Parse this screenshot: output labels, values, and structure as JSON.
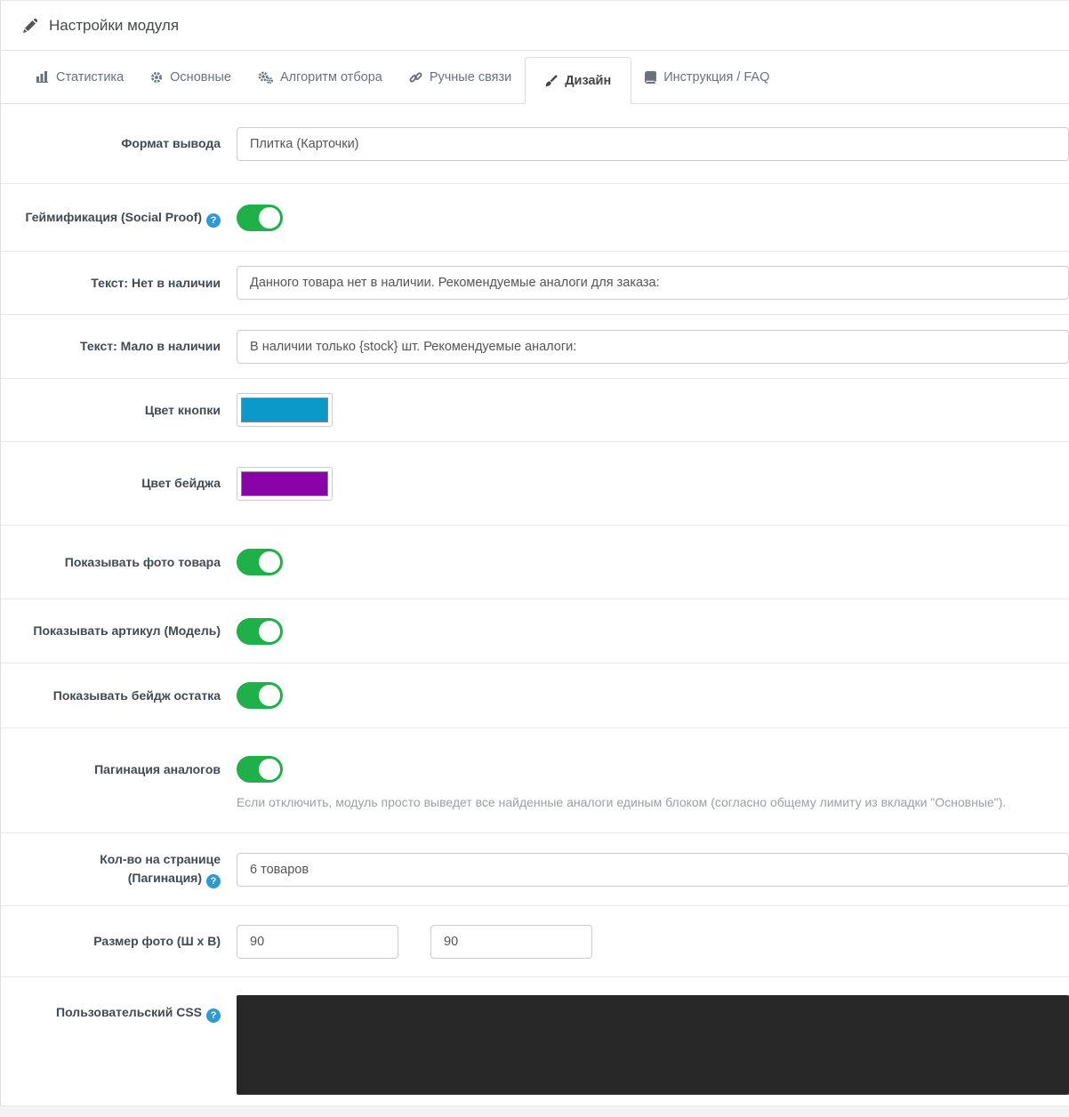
{
  "header": {
    "title": "Настройки модуля",
    "icon": "pencil-icon"
  },
  "tabs": {
    "statistics": {
      "label": "Статистика",
      "icon": "bar-chart-icon",
      "active": false
    },
    "general": {
      "label": "Основные",
      "icon": "gear-icon",
      "active": false
    },
    "algorithm": {
      "label": "Алгоритм отбора",
      "icon": "gears-icon",
      "active": false
    },
    "manual_links": {
      "label": "Ручные связи",
      "icon": "link-icon",
      "active": false
    },
    "design": {
      "label": "Дизайн",
      "icon": "paint-brush-icon",
      "active": true
    },
    "faq": {
      "label": "Инструкция / FAQ",
      "icon": "book-icon",
      "active": false
    }
  },
  "form": {
    "output_format": {
      "label": "Формат вывода",
      "value": "Плитка (Карточки)"
    },
    "gamification": {
      "label": "Геймификация (Social Proof)",
      "enabled": true
    },
    "text_out_of_stock": {
      "label": "Текст: Нет в наличии",
      "value": "Данного товара нет в наличии. Рекомендуемые аналоги для заказа:"
    },
    "text_low_stock": {
      "label": "Текст: Мало в наличии",
      "value": "В наличии только {stock} шт. Рекомендуемые аналоги:"
    },
    "button_color": {
      "label": "Цвет кнопки",
      "value": "#0a99c9"
    },
    "badge_color": {
      "label": "Цвет бейджа",
      "value": "#8a03a8"
    },
    "show_photo": {
      "label": "Показывать фото товара",
      "enabled": true
    },
    "show_model": {
      "label": "Показывать артикул (Модель)",
      "enabled": true
    },
    "show_stock_badge": {
      "label": "Показывать бейдж остатка",
      "enabled": true
    },
    "pagination": {
      "label": "Пагинация аналогов",
      "enabled": true,
      "help": "Если отключить, модуль просто выведет все найденные аналоги единым блоком (согласно общему лимиту из вкладки \"Основные\")."
    },
    "per_page": {
      "label_line1": "Кол-во на странице",
      "label_line2": "(Пагинация)",
      "value": "6 товаров"
    },
    "photo_size": {
      "label": "Размер фото (Ш х В)",
      "width": "90",
      "height": "90"
    },
    "custom_css": {
      "label": "Пользовательский CSS",
      "value": ""
    }
  },
  "colors": {
    "toggle_on": "#1fb04a",
    "help_icon": "#2d9ad3",
    "css_editor_bg": "#282828"
  },
  "help_icon_glyph": "?"
}
